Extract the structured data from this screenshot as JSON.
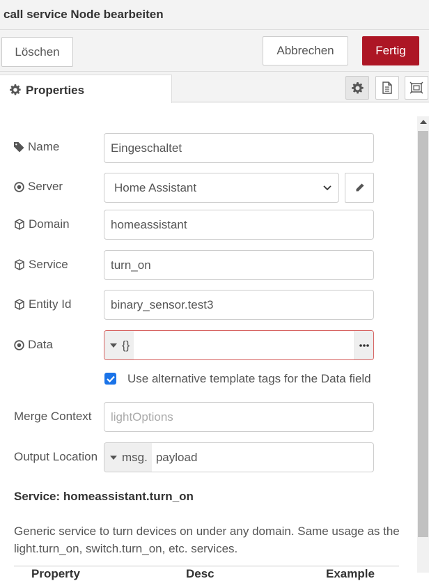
{
  "dialog": {
    "title": "call service Node bearbeiten",
    "delete_label": "Löschen",
    "cancel_label": "Abbrechen",
    "done_label": "Fertig",
    "tab_properties": "Properties",
    "icons": [
      "gear-icon",
      "description-icon",
      "appearance-icon"
    ]
  },
  "form": {
    "name_label": "Name",
    "name_value": "Eingeschaltet",
    "server_label": "Server",
    "server_value": "Home Assistant",
    "domain_label": "Domain",
    "domain_value": "homeassistant",
    "service_label": "Service",
    "service_value": "turn_on",
    "entity_label": "Entity Id",
    "entity_value": "binary_sensor.test3",
    "data_label": "Data",
    "data_type": "{}",
    "data_value": "",
    "alt_template_checked": true,
    "alt_template_label": "Use alternative template tags for the Data field",
    "merge_label": "Merge Context",
    "merge_placeholder": "lightOptions",
    "output_label": "Output Location",
    "output_type": "msg.",
    "output_value": "payload"
  },
  "service_info": {
    "title": "Service: homeassistant.turn_on",
    "description": "Generic service to turn devices on under any domain. Same usage as the light.turn_on, switch.turn_on, etc. services.",
    "columns": [
      "Property",
      "Desc",
      "Example"
    ]
  },
  "colors": {
    "primary": "#ad1625",
    "error_border": "#d6615f",
    "checkbox": "#1a73e8"
  }
}
